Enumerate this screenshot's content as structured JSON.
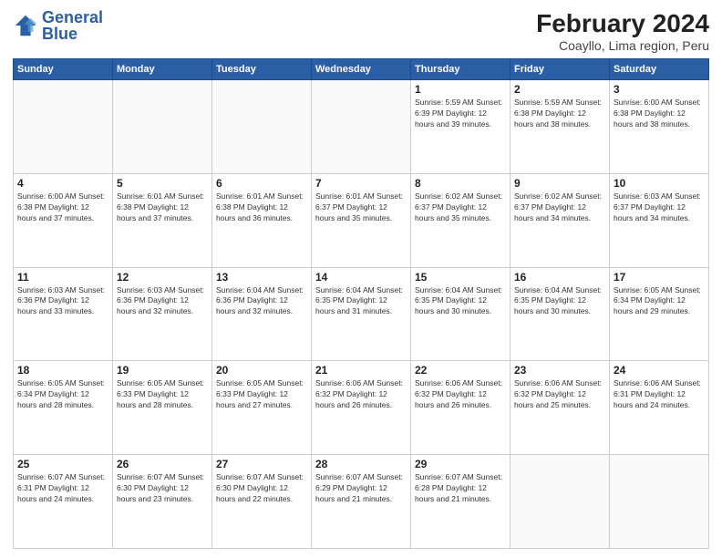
{
  "logo": {
    "line1": "General",
    "line2": "Blue"
  },
  "title": "February 2024",
  "subtitle": "Coayllo, Lima region, Peru",
  "weekdays": [
    "Sunday",
    "Monday",
    "Tuesday",
    "Wednesday",
    "Thursday",
    "Friday",
    "Saturday"
  ],
  "weeks": [
    [
      {
        "day": "",
        "info": ""
      },
      {
        "day": "",
        "info": ""
      },
      {
        "day": "",
        "info": ""
      },
      {
        "day": "",
        "info": ""
      },
      {
        "day": "1",
        "info": "Sunrise: 5:59 AM\nSunset: 6:39 PM\nDaylight: 12 hours\nand 39 minutes."
      },
      {
        "day": "2",
        "info": "Sunrise: 5:59 AM\nSunset: 6:38 PM\nDaylight: 12 hours\nand 38 minutes."
      },
      {
        "day": "3",
        "info": "Sunrise: 6:00 AM\nSunset: 6:38 PM\nDaylight: 12 hours\nand 38 minutes."
      }
    ],
    [
      {
        "day": "4",
        "info": "Sunrise: 6:00 AM\nSunset: 6:38 PM\nDaylight: 12 hours\nand 37 minutes."
      },
      {
        "day": "5",
        "info": "Sunrise: 6:01 AM\nSunset: 6:38 PM\nDaylight: 12 hours\nand 37 minutes."
      },
      {
        "day": "6",
        "info": "Sunrise: 6:01 AM\nSunset: 6:38 PM\nDaylight: 12 hours\nand 36 minutes."
      },
      {
        "day": "7",
        "info": "Sunrise: 6:01 AM\nSunset: 6:37 PM\nDaylight: 12 hours\nand 35 minutes."
      },
      {
        "day": "8",
        "info": "Sunrise: 6:02 AM\nSunset: 6:37 PM\nDaylight: 12 hours\nand 35 minutes."
      },
      {
        "day": "9",
        "info": "Sunrise: 6:02 AM\nSunset: 6:37 PM\nDaylight: 12 hours\nand 34 minutes."
      },
      {
        "day": "10",
        "info": "Sunrise: 6:03 AM\nSunset: 6:37 PM\nDaylight: 12 hours\nand 34 minutes."
      }
    ],
    [
      {
        "day": "11",
        "info": "Sunrise: 6:03 AM\nSunset: 6:36 PM\nDaylight: 12 hours\nand 33 minutes."
      },
      {
        "day": "12",
        "info": "Sunrise: 6:03 AM\nSunset: 6:36 PM\nDaylight: 12 hours\nand 32 minutes."
      },
      {
        "day": "13",
        "info": "Sunrise: 6:04 AM\nSunset: 6:36 PM\nDaylight: 12 hours\nand 32 minutes."
      },
      {
        "day": "14",
        "info": "Sunrise: 6:04 AM\nSunset: 6:35 PM\nDaylight: 12 hours\nand 31 minutes."
      },
      {
        "day": "15",
        "info": "Sunrise: 6:04 AM\nSunset: 6:35 PM\nDaylight: 12 hours\nand 30 minutes."
      },
      {
        "day": "16",
        "info": "Sunrise: 6:04 AM\nSunset: 6:35 PM\nDaylight: 12 hours\nand 30 minutes."
      },
      {
        "day": "17",
        "info": "Sunrise: 6:05 AM\nSunset: 6:34 PM\nDaylight: 12 hours\nand 29 minutes."
      }
    ],
    [
      {
        "day": "18",
        "info": "Sunrise: 6:05 AM\nSunset: 6:34 PM\nDaylight: 12 hours\nand 28 minutes."
      },
      {
        "day": "19",
        "info": "Sunrise: 6:05 AM\nSunset: 6:33 PM\nDaylight: 12 hours\nand 28 minutes."
      },
      {
        "day": "20",
        "info": "Sunrise: 6:05 AM\nSunset: 6:33 PM\nDaylight: 12 hours\nand 27 minutes."
      },
      {
        "day": "21",
        "info": "Sunrise: 6:06 AM\nSunset: 6:32 PM\nDaylight: 12 hours\nand 26 minutes."
      },
      {
        "day": "22",
        "info": "Sunrise: 6:06 AM\nSunset: 6:32 PM\nDaylight: 12 hours\nand 26 minutes."
      },
      {
        "day": "23",
        "info": "Sunrise: 6:06 AM\nSunset: 6:32 PM\nDaylight: 12 hours\nand 25 minutes."
      },
      {
        "day": "24",
        "info": "Sunrise: 6:06 AM\nSunset: 6:31 PM\nDaylight: 12 hours\nand 24 minutes."
      }
    ],
    [
      {
        "day": "25",
        "info": "Sunrise: 6:07 AM\nSunset: 6:31 PM\nDaylight: 12 hours\nand 24 minutes."
      },
      {
        "day": "26",
        "info": "Sunrise: 6:07 AM\nSunset: 6:30 PM\nDaylight: 12 hours\nand 23 minutes."
      },
      {
        "day": "27",
        "info": "Sunrise: 6:07 AM\nSunset: 6:30 PM\nDaylight: 12 hours\nand 22 minutes."
      },
      {
        "day": "28",
        "info": "Sunrise: 6:07 AM\nSunset: 6:29 PM\nDaylight: 12 hours\nand 21 minutes."
      },
      {
        "day": "29",
        "info": "Sunrise: 6:07 AM\nSunset: 6:28 PM\nDaylight: 12 hours\nand 21 minutes."
      },
      {
        "day": "",
        "info": ""
      },
      {
        "day": "",
        "info": ""
      }
    ]
  ]
}
